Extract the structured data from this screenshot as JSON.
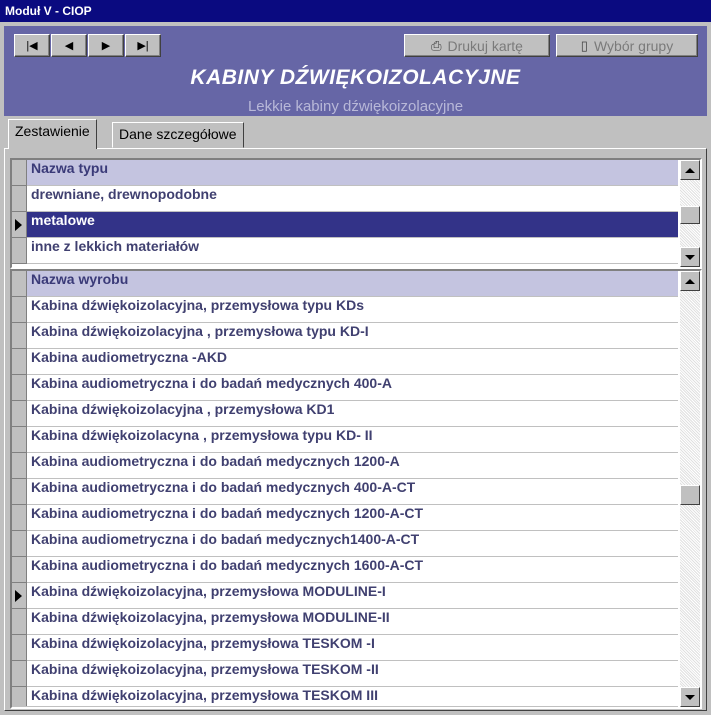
{
  "window": {
    "title": "Moduł V - CIOP"
  },
  "toolbar": {
    "nav_icons": [
      "first-record-icon",
      "previous-record-icon",
      "next-record-icon",
      "last-record-icon"
    ],
    "print_label": "Drukuj kartę",
    "group_label": "Wybór grupy"
  },
  "header": {
    "title": "KABINY DŹWIĘKOIZOLACYJNE",
    "subtitle": "Lekkie kabiny dźwiękoizolacyjne"
  },
  "tabs": [
    "Zestawienie",
    "Dane szczegółowe"
  ],
  "types": {
    "column": "Nazwa typu",
    "rows": [
      "drewniane, drewnopodobne",
      "metalowe",
      "inne z lekkich materiałów"
    ],
    "selected_index": 1
  },
  "products": {
    "column": "Nazwa wyrobu",
    "rows": [
      "Kabina dźwiękoizolacyjna, przemysłowa typu KDs",
      "Kabina dźwiękoizolacyjna , przemysłowa typu KD-I",
      "Kabina audiometryczna -AKD",
      "Kabina audiometryczna i do badań medycznych 400-A",
      "Kabina dźwiękoizolacyjna , przemysłowa KD1",
      "Kabina dźwiękoizolacyna , przemysłowa typu KD- II",
      "Kabina audiometryczna i do badań medycznych 1200-A",
      "Kabina audiometryczna i do badań medycznych 400-A-CT",
      "Kabina audiometryczna i do badań medycznych 1200-A-CT",
      "Kabina audiometryczna i do badań medycznych1400-A-CT",
      "Kabina audiometryczna i do badań medycznych 1600-A-CT",
      "Kabina dźwiękoizolacyjna, przemysłowa MODULINE-I",
      "Kabina dźwiękoizolacyjna, przemysłowa MODULINE-II",
      "Kabina dźwiękoizolacyjna, przemysłowa TESKOM -I",
      "Kabina dźwiękoizolacyjna, przemysłowa TESKOM -II",
      "Kabina dźwiękoizolacyjna, przemysłowa TESKOM III"
    ],
    "current_index": 11
  },
  "colors": {
    "accent": "#6666a6",
    "title_bar": "#0a0a80",
    "selection": "#333388",
    "header_row": "#c4c4e0"
  }
}
